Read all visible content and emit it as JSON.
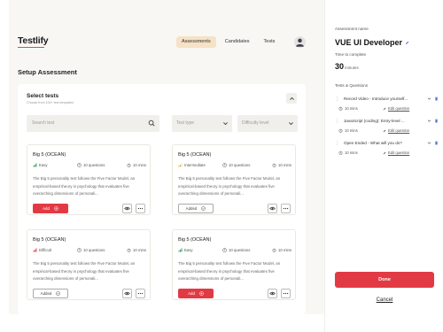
{
  "header": {
    "logo": "Testlify",
    "nav": [
      "Assessments",
      "Candidates",
      "Tests"
    ]
  },
  "page": {
    "title": "Setup Assessment"
  },
  "select_tests": {
    "title": "Select tests",
    "subtitle": "Choose from 100+ test templates",
    "search_placeholder": "Search test",
    "filter_type_placeholder": "Test type",
    "filter_difficulty_placeholder": "Difficulty level",
    "cards": [
      {
        "name": "Big 5 (OCEAN)",
        "level": "Easy",
        "level_color": "#2e9d5a",
        "questions": "10 questions",
        "duration": "10 mins",
        "description": "The Big 5 personality test follows the Five Factor Model, an empirical-based theory in psychology that evaluates five overarching dimensions of personali...",
        "action": "Add"
      },
      {
        "name": "Big 5 (OCEAN)",
        "level": "Intermediate",
        "level_color": "#e8b21e",
        "questions": "10 questions",
        "duration": "10 mins",
        "description": "The Big 5 personality test follows the Five Factor Model, an empirical-based theory in psychology that evaluates five overarching dimensions of personali...",
        "action": "Added"
      },
      {
        "name": "Big 5 (OCEAN)",
        "level": "Difficult",
        "level_color": "#e23a44",
        "questions": "10 questions",
        "duration": "10 mins",
        "description": "The Big 5 personality test follows the Five Factor Model, an empirical-based theory in psychology that evaluates five overarching dimensions of personali...",
        "action": "Added"
      },
      {
        "name": "Big 5 (OCEAN)",
        "level": "Easy",
        "level_color": "#2e9d5a",
        "questions": "10 questions",
        "duration": "10 mins",
        "description": "The Big 5 personality test follows the Five Factor Model, an empirical-based theory in psychology that evaluates five overarching dimensions of personali...",
        "action": "Add"
      }
    ]
  },
  "sidebar": {
    "name_label": "Assessment name",
    "name_value": "VUE UI Developer",
    "time_label": "Time to complete",
    "time_value": "30",
    "time_unit": "minutes",
    "tq_label": "Tests & Questions",
    "items": [
      {
        "title": "Record Video - Introduce yourself...",
        "duration": "10 mins",
        "edit": "Edit question"
      },
      {
        "title": "JavaScript (coding): Entry-level ...",
        "duration": "10 mins",
        "edit": "Edit question"
      },
      {
        "title": "Open Ended - What will you do?",
        "duration": "10 mins",
        "edit": "Edit question"
      }
    ],
    "done_label": "Done",
    "cancel_label": "Cancel"
  },
  "colors": {
    "accent": "#e23a44",
    "nav_active_bg": "#f6e2c6",
    "panel_bg": "#f8f7f4"
  }
}
